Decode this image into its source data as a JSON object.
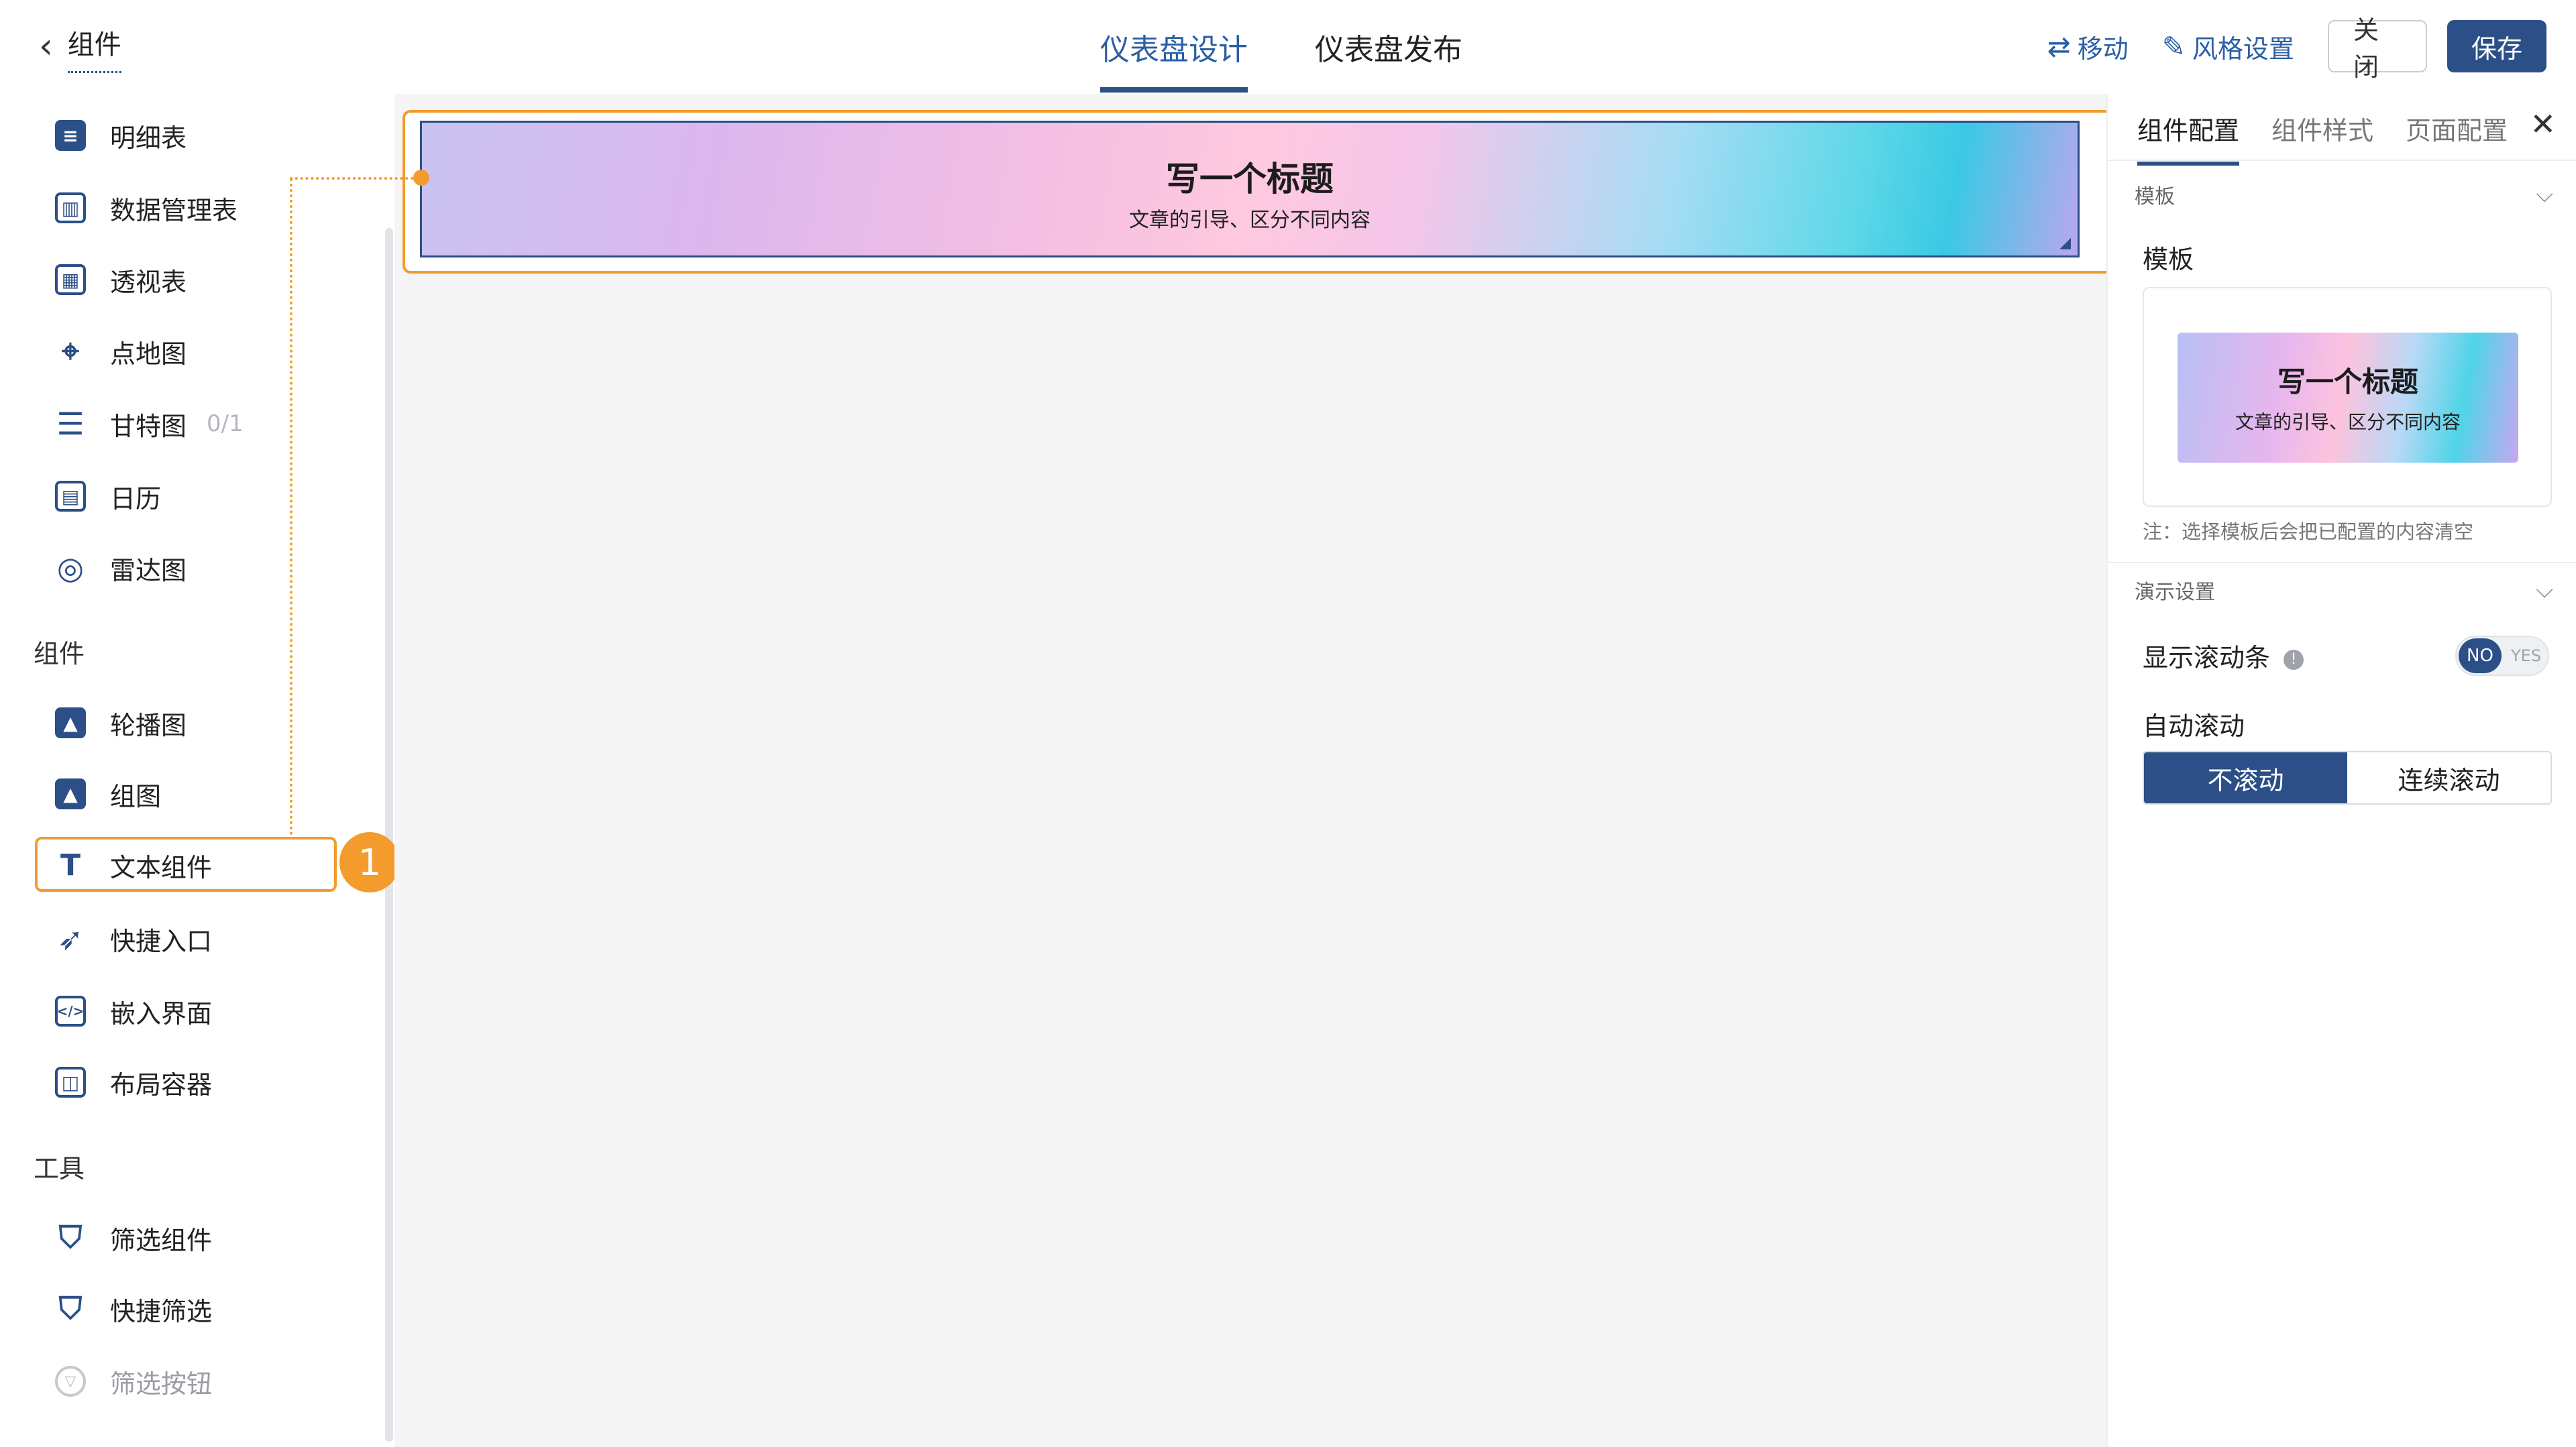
{
  "header": {
    "back_label": "组件",
    "tabs": [
      {
        "label": "仪表盘设计",
        "active": true
      },
      {
        "label": "仪表盘发布",
        "active": false
      }
    ],
    "move_label": "移动",
    "style_label": "风格设置",
    "close_label": "关闭",
    "save_label": "保存"
  },
  "sidebar": {
    "items_top": [
      {
        "label": "明细表",
        "icon": "detail-table-icon"
      },
      {
        "label": "数据管理表",
        "icon": "data-manage-table-icon"
      },
      {
        "label": "透视表",
        "icon": "pivot-table-icon"
      },
      {
        "label": "点地图",
        "icon": "point-map-icon"
      },
      {
        "label": "甘特图",
        "icon": "gantt-icon",
        "count": "0/1"
      },
      {
        "label": "日历",
        "icon": "calendar-icon"
      },
      {
        "label": "雷达图",
        "icon": "radar-icon"
      }
    ],
    "group_components": "组件",
    "items_components": [
      {
        "label": "轮播图",
        "icon": "carousel-icon"
      },
      {
        "label": "组图",
        "icon": "image-group-icon"
      },
      {
        "label": "文本组件",
        "icon": "text-icon",
        "selected": true
      },
      {
        "label": "快捷入口",
        "icon": "rocket-icon"
      },
      {
        "label": "嵌入界面",
        "icon": "embed-code-icon"
      },
      {
        "label": "布局容器",
        "icon": "layout-container-icon"
      }
    ],
    "group_tools": "工具",
    "items_tools": [
      {
        "label": "筛选组件",
        "icon": "filter-icon"
      },
      {
        "label": "快捷筛选",
        "icon": "quick-filter-icon"
      },
      {
        "label": "筛选按钮",
        "icon": "filter-button-icon",
        "disabled": true
      }
    ],
    "callout_badge": "1"
  },
  "canvas": {
    "banner_title": "写一个标题",
    "banner_subtitle": "文章的引导、区分不同内容"
  },
  "panel": {
    "tabs": [
      {
        "label": "组件配置",
        "active": true
      },
      {
        "label": "组件样式",
        "active": false
      },
      {
        "label": "页面配置",
        "active": false
      }
    ],
    "template_section": "模板",
    "template_label": "模板",
    "template_title": "写一个标题",
    "template_subtitle": "文章的引导、区分不同内容",
    "template_note": "注：选择模板后会把已配置的内容清空",
    "demo_section": "演示设置",
    "show_scrollbar_label": "显示滚动条",
    "toggle_on": "NO",
    "toggle_off": "YES",
    "auto_scroll_label": "自动滚动",
    "scroll_options": [
      {
        "label": "不滚动",
        "active": true
      },
      {
        "label": "连续滚动",
        "active": false
      }
    ]
  },
  "colors": {
    "brand": "#2b4f86",
    "accent": "#f39b2c"
  }
}
